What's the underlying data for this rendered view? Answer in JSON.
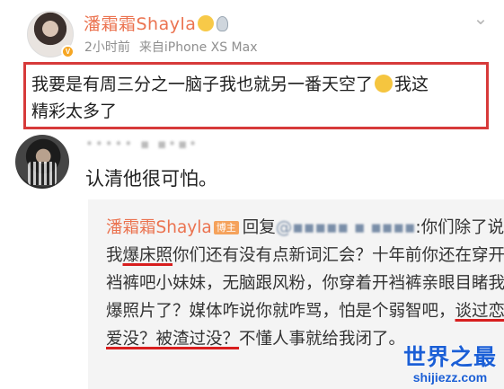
{
  "post": {
    "author": "潘霜霜Shayla",
    "time": "2小时前",
    "source": "来自iPhone XS Max",
    "body_line1": "我要是有周三分之一脑子我也就另一番天空了",
    "body_line1_tail": "我这",
    "body_line2": "精彩太多了",
    "menu_icon": "chevron-down-icon"
  },
  "comment": {
    "username": "•••••  ▪ ▪•▪•",
    "text": "认清他很可怕。"
  },
  "reply": {
    "author": "潘霜霜Shayla",
    "badge": "博主",
    "prefix": "回复",
    "mention": "@▪▪▪▪▪ ▪ ▪▪▪▪",
    "t1": ":你们除了说我",
    "u1": "爆床照",
    "t2": "你们还有没有点新词汇会？十年前你还在穿开裆裤吧小妹妹，无脑跟风粉，你穿着开裆裤亲眼目睹我爆照片了？媒体咋说你就咋骂，怕是个弱智吧，",
    "u2": "谈过恋爱没？被渣过没？",
    "t3": "不懂人事就给我闭了。"
  },
  "watermark": {
    "title": "世界之最",
    "url": "shijiezz.com"
  }
}
